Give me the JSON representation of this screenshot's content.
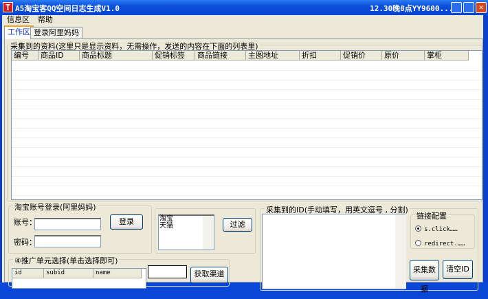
{
  "window": {
    "title": "A5淘宝客QQ空间日志生成V1.0",
    "right_title": "12.30晚8点YY9600..."
  },
  "menu": [
    "信息区",
    "帮助"
  ],
  "tabs": [
    "工作区",
    "登录阿里妈妈"
  ],
  "collected": {
    "label": "采集到的资料(这里只是显示资料，无需操作，发送的内容在下面的列表里)",
    "columns": [
      "编号",
      "商品ID",
      "商品标题",
      "促销标签",
      "商品链接",
      "主图地址",
      "折扣",
      "促销价",
      "原价",
      "掌柜"
    ]
  },
  "login": {
    "label": "淘宝账号登录(阿里妈妈)",
    "account_label": "账号：",
    "password_label": "密码：",
    "account_value": "",
    "password_value": "",
    "login_button": "登录"
  },
  "filter": {
    "options": [
      "淘宝",
      "天猫"
    ],
    "button": "过滤"
  },
  "unit": {
    "label": "④推广单元选择(单击选择即可)",
    "columns": [
      "id",
      "subid",
      "name"
    ],
    "input_value": "",
    "button": "获取渠道"
  },
  "ids": {
    "label": "采集到的ID(手动填写，用英文逗号 , 分割)",
    "value": "",
    "link_config": {
      "label": "链接配置",
      "options": [
        "s.click……",
        "redirect.……"
      ],
      "selected": 0
    },
    "collect_button": "采集数据",
    "clear_button": "清空ID"
  }
}
